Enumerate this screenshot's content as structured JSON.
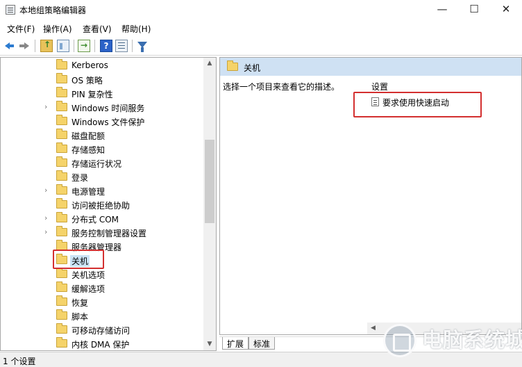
{
  "window": {
    "title": "本地组策略编辑器",
    "minimize_glyph": "—",
    "maximize_glyph": "☐",
    "close_glyph": "✕"
  },
  "menu": {
    "items": [
      "文件(F)",
      "操作(A)",
      "查看(V)",
      "帮助(H)"
    ]
  },
  "toolbar": {
    "icons": [
      "back-icon",
      "forward-icon",
      "up-folder-icon",
      "show-hide-tree-icon",
      "export-list-icon",
      "help-icon",
      "view-icon",
      "filter-icon"
    ],
    "help_glyph": "?"
  },
  "tree": {
    "items": [
      {
        "label": "Kerberos",
        "expandable": false
      },
      {
        "label": "OS 策略",
        "expandable": false
      },
      {
        "label": "PIN 复杂性",
        "expandable": false
      },
      {
        "label": "Windows 时间服务",
        "expandable": true
      },
      {
        "label": "Windows 文件保护",
        "expandable": false
      },
      {
        "label": "磁盘配额",
        "expandable": false
      },
      {
        "label": "存储感知",
        "expandable": false
      },
      {
        "label": "存储运行状况",
        "expandable": false
      },
      {
        "label": "登录",
        "expandable": false
      },
      {
        "label": "电源管理",
        "expandable": true
      },
      {
        "label": "访问被拒绝协助",
        "expandable": false
      },
      {
        "label": "分布式 COM",
        "expandable": true
      },
      {
        "label": "服务控制管理器设置",
        "expandable": true
      },
      {
        "label": "服务器管理器",
        "expandable": false
      },
      {
        "label": "关机",
        "expandable": false,
        "selected": true
      },
      {
        "label": "关机选项",
        "expandable": false
      },
      {
        "label": "缓解选项",
        "expandable": false
      },
      {
        "label": "恢复",
        "expandable": false
      },
      {
        "label": "脚本",
        "expandable": false
      },
      {
        "label": "可移动存储访问",
        "expandable": false
      },
      {
        "label": "内核 DMA 保护",
        "expandable": false
      }
    ],
    "expander_glyph": "›"
  },
  "detail": {
    "header_title": "关机",
    "description": "选择一个项目来查看它的描述。",
    "settings_header": "设置",
    "settings": [
      "要求使用快速启动"
    ]
  },
  "tabs": [
    "扩展",
    "标准"
  ],
  "status": {
    "text": "1 个设置"
  },
  "scroll_glyphs": {
    "up": "▲",
    "down": "▼",
    "left": "◀"
  },
  "watermark": {
    "text": "电脑系统城"
  },
  "colors": {
    "highlight_box": "#d32f2f",
    "header_bg": "#cfe1f3",
    "selection_bg": "#cce4f7"
  }
}
